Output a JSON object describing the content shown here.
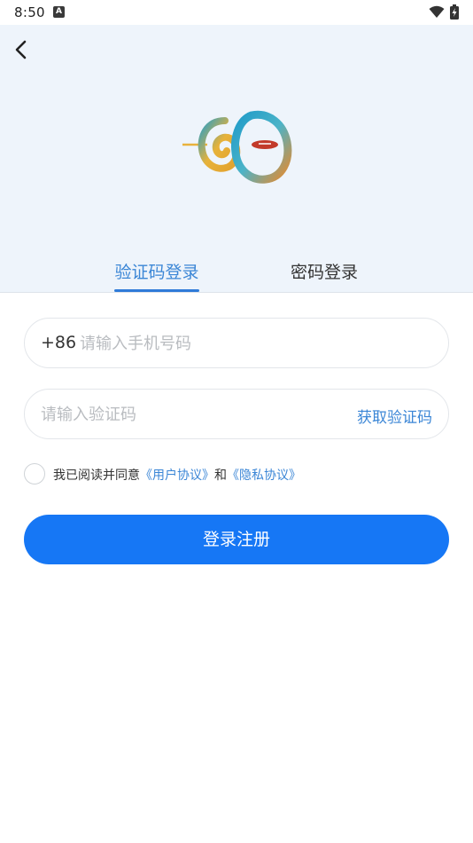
{
  "status_bar": {
    "time": "8:50",
    "notification_icon": "A"
  },
  "header": {
    "back_icon": "chevron-left-icon",
    "logo_icon": "infinity-eye-logo",
    "tabs": [
      {
        "label": "验证码登录",
        "active": true
      },
      {
        "label": "密码登录",
        "active": false
      }
    ]
  },
  "form": {
    "phone": {
      "prefix": "+86",
      "placeholder": "请输入手机号码",
      "value": ""
    },
    "code": {
      "placeholder": "请输入验证码",
      "value": "",
      "get_code_label": "获取验证码"
    },
    "agreement": {
      "checked": false,
      "prefix_text": "我已阅读并同意",
      "user_agreement": "《用户协议》",
      "and_text": "和",
      "privacy_policy": "《隐私协议》"
    },
    "submit_label": "登录注册"
  },
  "colors": {
    "accent": "#1677f5",
    "link": "#3b86d6",
    "header_bg": "#eef4fb"
  }
}
